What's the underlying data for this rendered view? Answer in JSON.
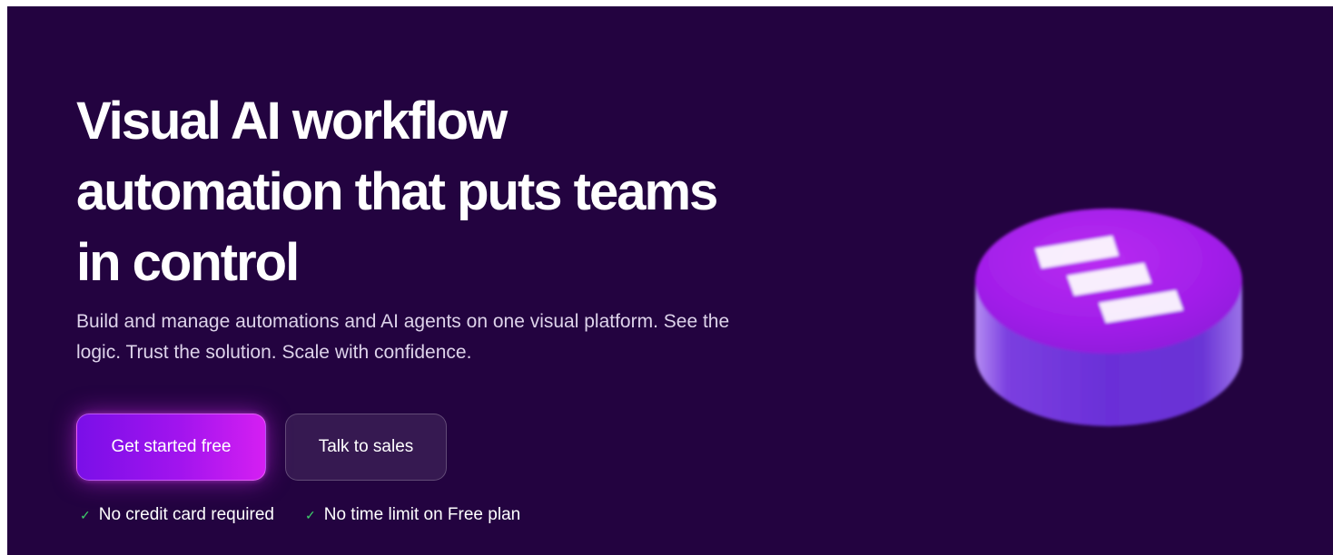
{
  "hero": {
    "title": "Visual AI workflow automation that puts teams in control",
    "subtitle": "Build and manage automations and AI agents on one visual platform. See the logic. Trust the solution. Scale with confidence."
  },
  "buttons": {
    "primary_label": "Get started free",
    "secondary_label": "Talk to sales"
  },
  "perks": [
    {
      "icon": "check-icon",
      "label": "No credit card required"
    },
    {
      "icon": "check-icon",
      "label": "No time limit on Free plan"
    }
  ],
  "colors": {
    "background": "#230340",
    "accent": "#a214ee",
    "check": "#3ecf6a"
  }
}
